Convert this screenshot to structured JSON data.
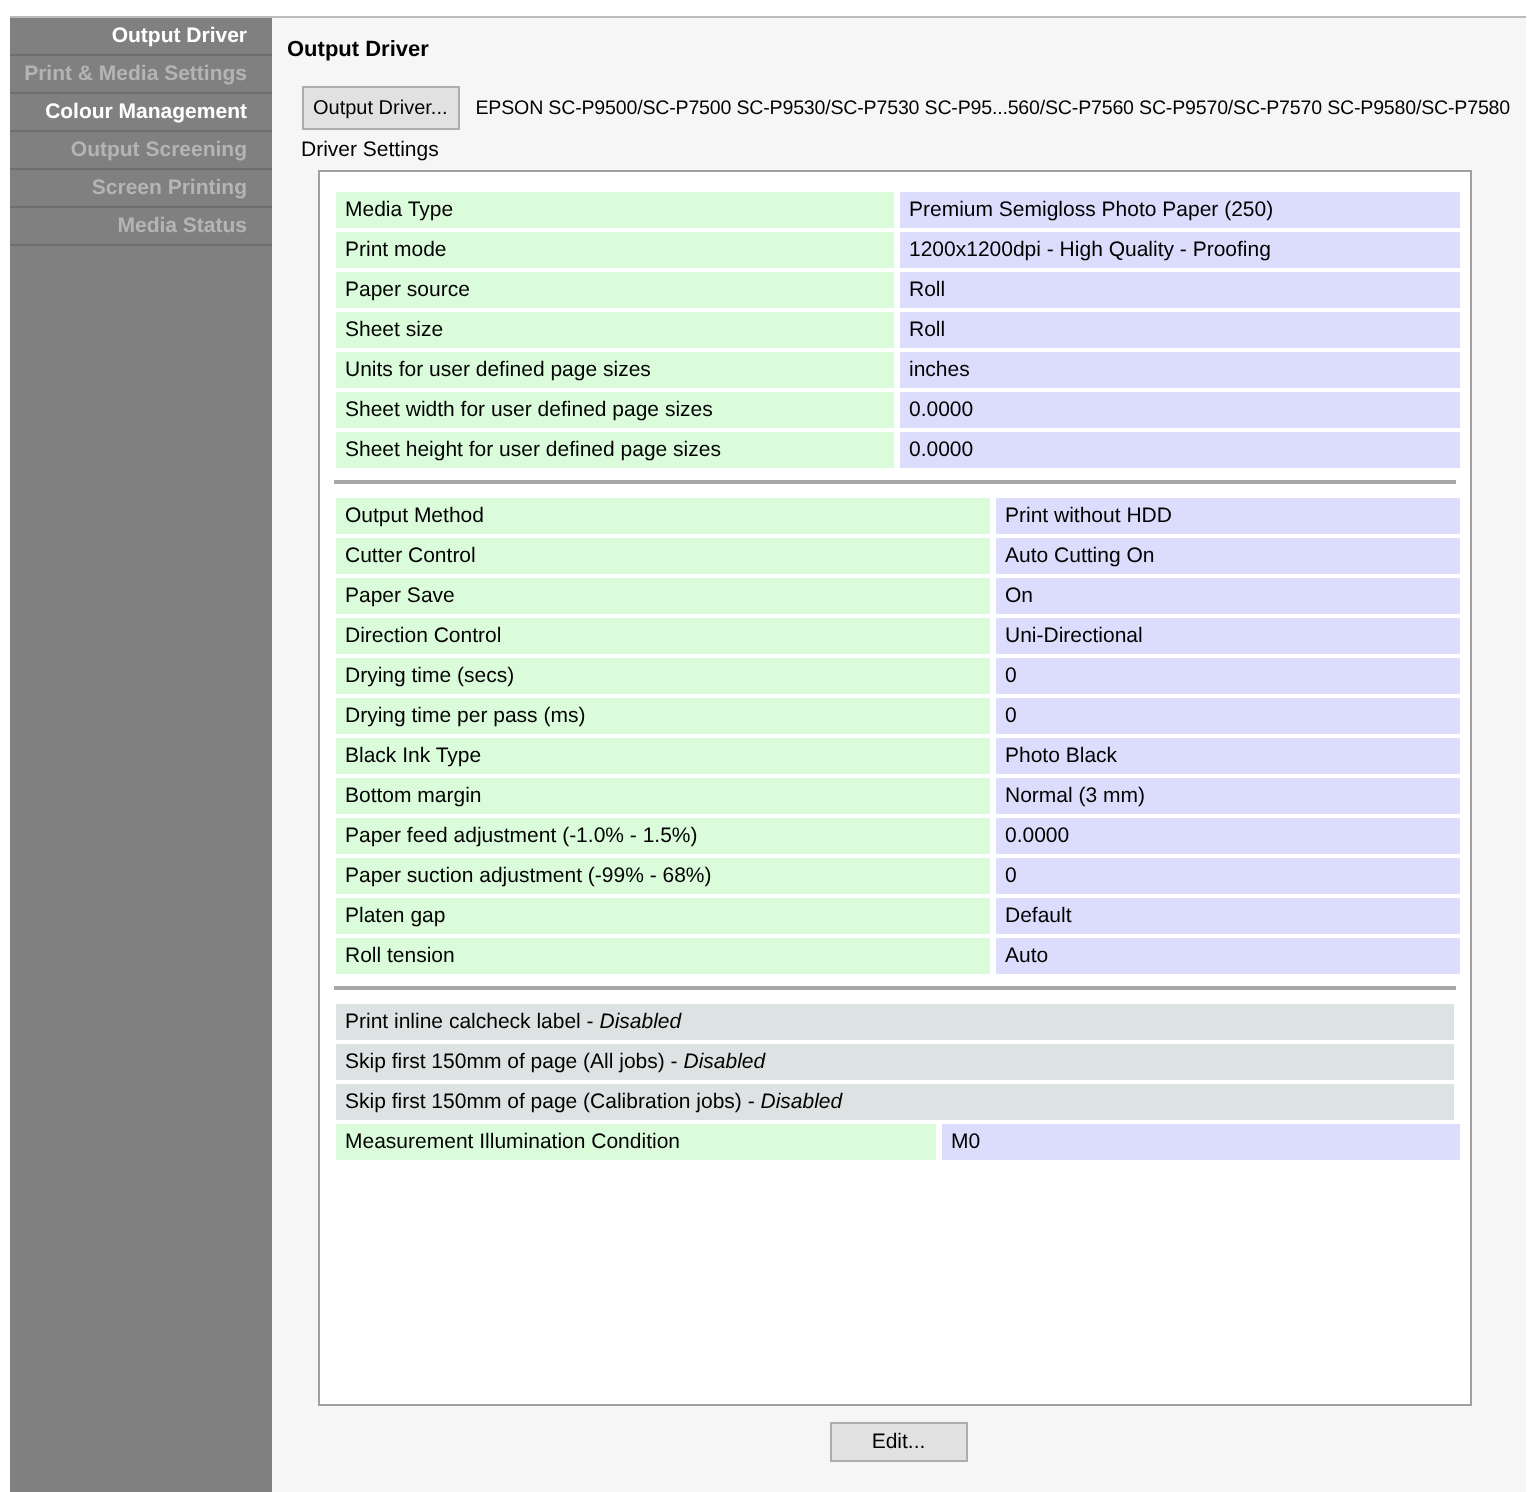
{
  "sidebar": {
    "items": [
      {
        "label": "Output Driver",
        "disabled": false
      },
      {
        "label": "Print & Media Settings",
        "disabled": true
      },
      {
        "label": "Colour Management",
        "disabled": false
      },
      {
        "label": "Output Screening",
        "disabled": true
      },
      {
        "label": "Screen Printing",
        "disabled": true
      },
      {
        "label": "Media Status",
        "disabled": true
      }
    ]
  },
  "panel": {
    "title": "Output Driver",
    "driver_button": "Output Driver...",
    "driver_name": "EPSON SC-P9500/SC-P7500 SC-P9530/SC-P7530 SC-P95...560/SC-P7560 SC-P9570/SC-P7570 SC-P9580/SC-P7580",
    "settings_label": "Driver Settings",
    "sections": [
      {
        "rows": [
          {
            "kind": "pair",
            "label": "Media Type",
            "value": "Premium Semigloss Photo Paper (250)"
          },
          {
            "kind": "pair",
            "label": "Print mode",
            "value": "1200x1200dpi - High Quality - Proofing"
          },
          {
            "kind": "pair",
            "label": "Paper source",
            "value": "Roll"
          },
          {
            "kind": "pair",
            "label": "Sheet size",
            "value": "Roll"
          },
          {
            "kind": "pair",
            "label": "Units for user defined page sizes",
            "value": "inches"
          },
          {
            "kind": "pair",
            "label": "Sheet width for user defined page sizes",
            "value": "0.0000"
          },
          {
            "kind": "pair",
            "label": "Sheet height for user defined page sizes",
            "value": "0.0000"
          }
        ]
      },
      {
        "rows": [
          {
            "kind": "pair",
            "label": "Output Method",
            "value": "Print without HDD"
          },
          {
            "kind": "pair",
            "label": "Cutter Control",
            "value": "Auto Cutting On"
          },
          {
            "kind": "pair",
            "label": "Paper Save",
            "value": "On"
          },
          {
            "kind": "pair",
            "label": "Direction Control",
            "value": "Uni-Directional"
          },
          {
            "kind": "pair",
            "label": "Drying time (secs)",
            "value": "0"
          },
          {
            "kind": "pair",
            "label": "Drying time per pass (ms)",
            "value": "0"
          },
          {
            "kind": "pair",
            "label": "Black Ink Type",
            "value": "Photo Black"
          },
          {
            "kind": "pair",
            "label": "Bottom margin",
            "value": "Normal (3 mm)"
          },
          {
            "kind": "pair",
            "label": "Paper feed adjustment (-1.0% - 1.5%)",
            "value": "0.0000"
          },
          {
            "kind": "pair",
            "label": "Paper suction adjustment (-99% - 68%)",
            "value": "0"
          },
          {
            "kind": "pair",
            "label": "Platen gap",
            "value": "Default"
          },
          {
            "kind": "pair",
            "label": "Roll tension",
            "value": "Auto"
          }
        ]
      },
      {
        "rows": [
          {
            "kind": "flag",
            "text": "Print inline calcheck label - *Disabled*"
          },
          {
            "kind": "flag",
            "text": "Skip first 150mm of page (All jobs) - *Disabled*"
          },
          {
            "kind": "flag",
            "text": "Skip first 150mm of page (Calibration jobs) - *Disabled*"
          },
          {
            "kind": "pair",
            "label": "Measurement Illumination Condition",
            "value": "M0"
          }
        ]
      }
    ],
    "edit_button": "Edit..."
  }
}
